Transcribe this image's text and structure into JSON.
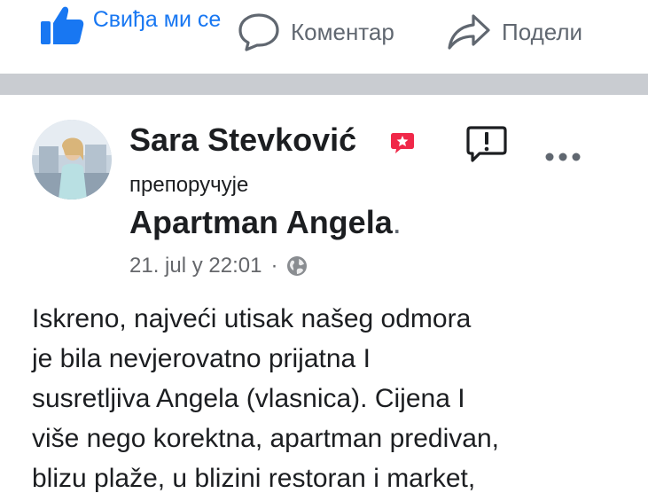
{
  "actions": {
    "like_label": "Свиђа ми се",
    "comment_label": "Коментар",
    "share_label": "Подели"
  },
  "post": {
    "author": "Sara Stevković",
    "verb": "препоручује",
    "page_name": "Apartman Angela",
    "page_name_suffix": ".",
    "timestamp": "21. jul у 22:01",
    "meta_separator": "·",
    "text": "Iskreno, najveći utisak našeg odmora\nje bila nevjerovatno prijatna I\nsusretljiva Angela (vlasnica). Cijena I\nviše nego korektna, apartman predivan,\nblizu plaže, u blizini restoran i market,"
  },
  "icons": {
    "like": "thumbs-up-icon",
    "comment": "comment-bubble-icon",
    "share": "share-arrow-icon",
    "recommend_badge": "recommend-star-badge-icon",
    "report": "report-exclamation-icon",
    "more": "more-dots-icon",
    "privacy": "globe-icon"
  },
  "colors": {
    "accent": "#1877f2",
    "muted": "#606770",
    "separator": "#c9ccd1",
    "recommend": "#f02849"
  }
}
